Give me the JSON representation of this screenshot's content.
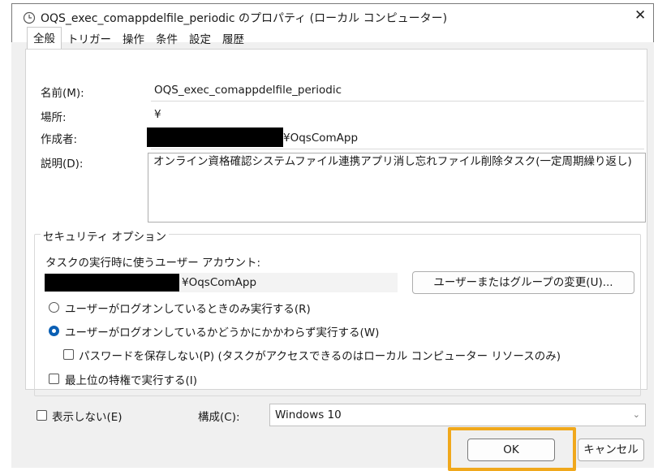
{
  "window": {
    "title": "OQS_exec_comappdelfile_periodic のプロパティ (ローカル コンピューター)",
    "close_glyph": "✕"
  },
  "tabs": [
    "全般",
    "トリガー",
    "操作",
    "条件",
    "設定",
    "履歴"
  ],
  "general": {
    "name_label": "名前(M):",
    "name_value": "OQS_exec_comappdelfile_periodic",
    "location_label": "場所:",
    "location_value": "¥",
    "author_label": "作成者:",
    "author_value": "¥OqsComApp",
    "description_label": "説明(D):",
    "description_value": "オンライン資格確認システムファイル連携アプリ消し忘れファイル削除タスク(一定周期繰り返し)"
  },
  "security": {
    "group_label": "セキュリティ オプション",
    "account_label": "タスクの実行時に使うユーザー アカウント:",
    "account_value": "¥OqsComApp",
    "change_button": "ユーザーまたはグループの変更(U)...",
    "radio_logged_on": "ユーザーがログオンしているときのみ実行する(R)",
    "radio_whether": "ユーザーがログオンしているかどうかにかかわらず実行する(W)",
    "no_store_password": "パスワードを保存しない(P) (タスクがアクセスできるのはローカル コンピューター リソースのみ)",
    "highest_privileges": "最上位の特権で実行する(I)",
    "selected_radio": "whether"
  },
  "bottom": {
    "hidden_label": "表示しない(E)",
    "config_label": "構成(C):",
    "config_value": "Windows 10",
    "ok_button": "OK",
    "cancel_button": "キャンセル"
  },
  "colors": {
    "highlight": "#f0a81c",
    "radio_checked": "#0a5fb4",
    "redaction": "#000000"
  },
  "icons": {
    "window": "clock-icon",
    "combo": "chevron-down-icon"
  }
}
